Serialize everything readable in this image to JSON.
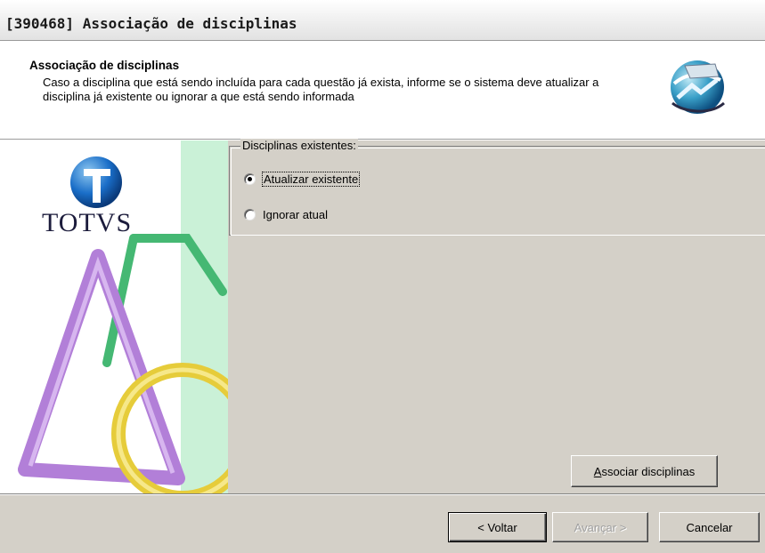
{
  "window": {
    "title": "[390468] Associação de disciplinas"
  },
  "header": {
    "title": "Associação de disciplinas",
    "description": "Caso a disciplina que está sendo incluída para cada questão já exista, informe se o sistema deve atualizar a disciplina já existente ou ignorar a que está sendo informada",
    "icon": "wizard-globe-icon"
  },
  "logo": {
    "text": "TOTVS",
    "icon": "totvs-t-globe-icon"
  },
  "options": {
    "group_label": "Disciplinas existentes:",
    "items": [
      {
        "label": "Atualizar existente",
        "checked": true
      },
      {
        "label": "Ignorar atual",
        "checked": false
      }
    ]
  },
  "actions": {
    "associate_pre": "",
    "associate_u": "A",
    "associate_post": "ssociar disciplinas"
  },
  "footer": {
    "back_label": "< Voltar",
    "next_label": "Avançar >",
    "cancel_label": "Cancelar"
  },
  "colors": {
    "face": "#d4d0c8",
    "totvs_blue": "#1a5fb4",
    "purple": "#a070d0",
    "green": "#40b070",
    "yellow": "#e8d040"
  }
}
